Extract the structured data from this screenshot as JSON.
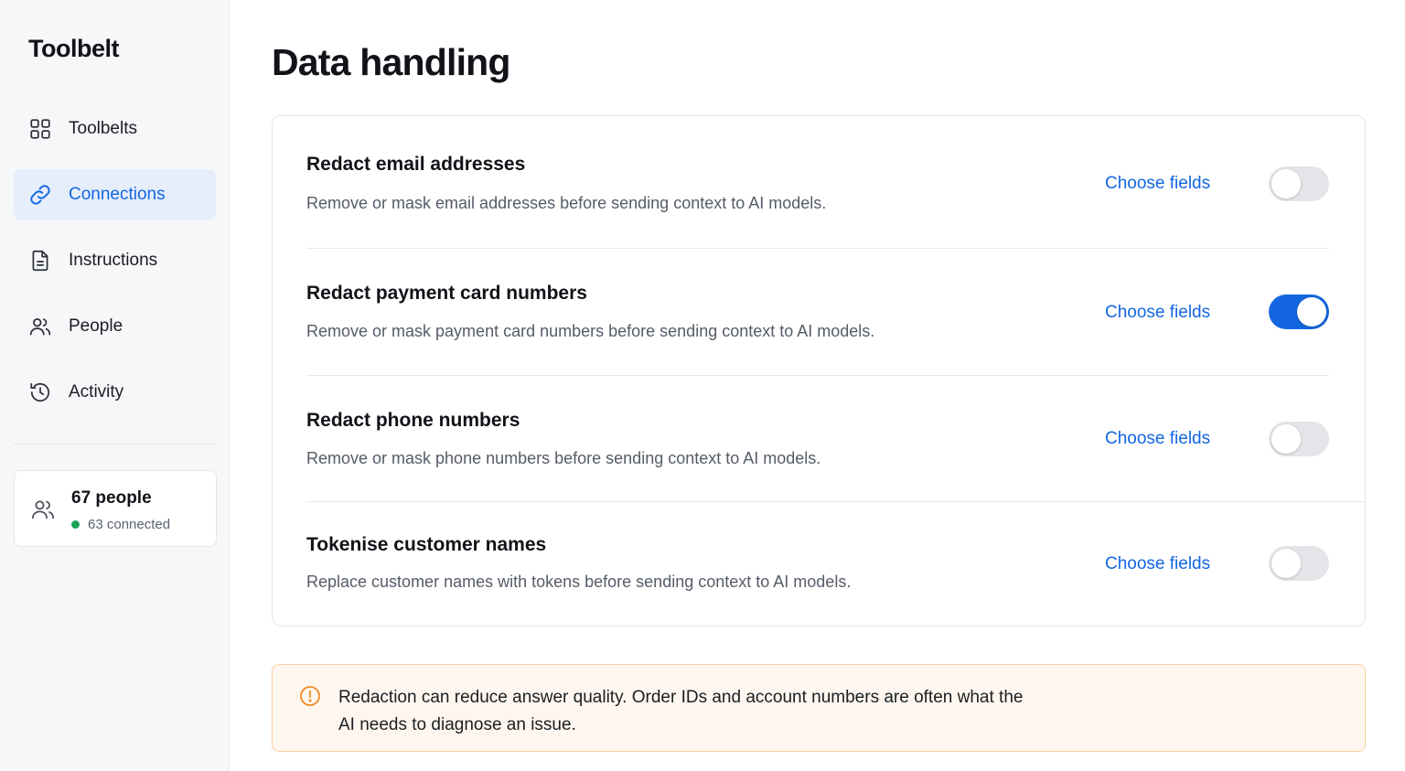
{
  "sidebar": {
    "brand": "Toolbelt",
    "items": [
      {
        "label": "Toolbelts",
        "icon": "grid-icon",
        "active": false
      },
      {
        "label": "Connections",
        "icon": "link-icon",
        "active": true
      },
      {
        "label": "Instructions",
        "icon": "document-icon",
        "active": false
      },
      {
        "label": "People",
        "icon": "people-icon",
        "active": false
      },
      {
        "label": "Activity",
        "icon": "history-icon",
        "active": false
      }
    ],
    "people_card": {
      "title": "67 people",
      "status": "63 connected",
      "icon": "people-icon",
      "status_color": "#19a35a"
    }
  },
  "main": {
    "title": "Data handling",
    "settings": [
      {
        "title": "Redact email addresses",
        "description": "Remove or mask email addresses before sending context to AI models.",
        "link": "Choose fields",
        "enabled": false
      },
      {
        "title": "Redact payment card numbers",
        "description": "Remove or mask payment card numbers before sending context to AI models.",
        "link": "Choose fields",
        "enabled": true
      },
      {
        "title": "Redact phone numbers",
        "description": "Remove or mask phone numbers before sending context to AI models.",
        "link": "Choose fields",
        "enabled": false
      },
      {
        "title": "Tokenise customer names",
        "description": "Replace customer names with tokens before sending context to AI models.",
        "link": "Choose fields",
        "enabled": false
      }
    ],
    "warning": {
      "icon": "alert-circle-icon",
      "text": "Redaction can reduce answer quality. Order IDs and account numbers are often what the AI needs to diagnose an issue."
    }
  },
  "colors": {
    "accent": "#1466e0",
    "warning_border": "#f4cf9f",
    "warning_bg": "#fff7ef",
    "warning_icon": "#f08a24"
  }
}
